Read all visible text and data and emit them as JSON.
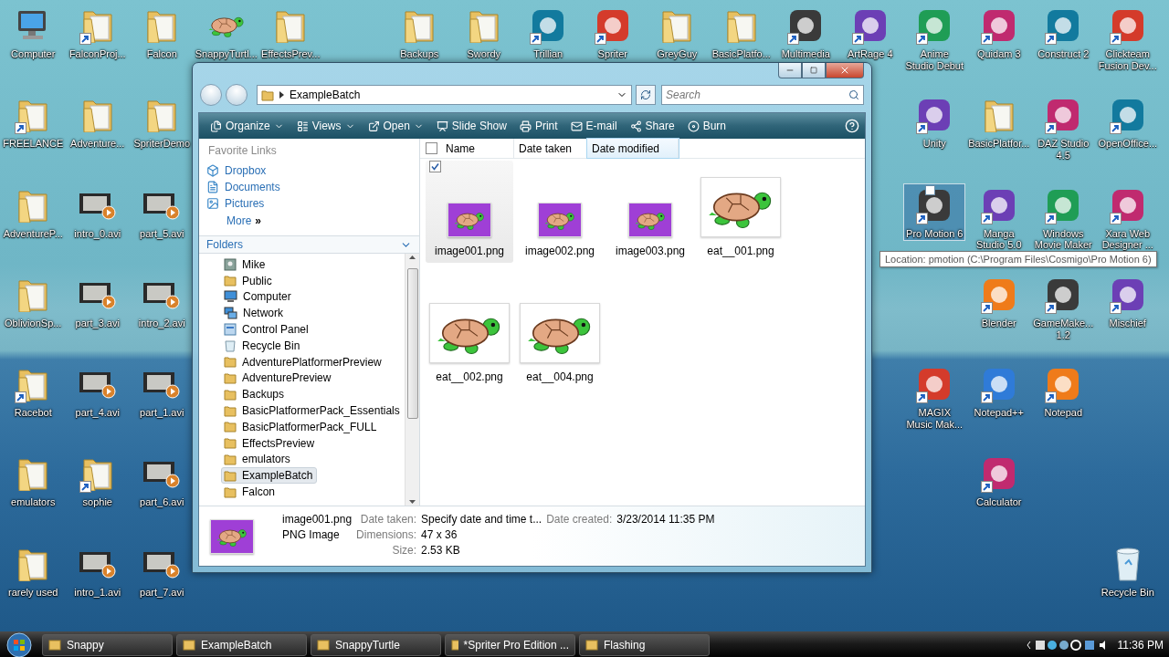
{
  "desktop_icons": [
    {
      "label": "Computer",
      "kind": "computer",
      "shortcut": false,
      "selected": false
    },
    {
      "label": "FalconProj...",
      "kind": "folder",
      "shortcut": true,
      "selected": false
    },
    {
      "label": "Falcon",
      "kind": "folder",
      "shortcut": false,
      "selected": false
    },
    {
      "label": "SnappyTurtl...",
      "kind": "turtle",
      "shortcut": false,
      "selected": false
    },
    {
      "label": "EffectsPrev...",
      "kind": "folder",
      "shortcut": false,
      "selected": false
    },
    {
      "label": "Backups",
      "kind": "folder",
      "shortcut": false,
      "selected": false
    },
    {
      "label": "Swordy",
      "kind": "folder",
      "shortcut": false,
      "selected": false
    },
    {
      "label": "Trillian",
      "kind": "app",
      "shortcut": true,
      "selected": false
    },
    {
      "label": "Spriter",
      "kind": "app",
      "shortcut": true,
      "selected": false
    },
    {
      "label": "GreyGuy",
      "kind": "folder",
      "shortcut": false,
      "selected": false
    },
    {
      "label": "BasicPlatfo...",
      "kind": "folder",
      "shortcut": false,
      "selected": false
    },
    {
      "label": "Multimedia",
      "kind": "app",
      "shortcut": true,
      "selected": false
    },
    {
      "label": "ArtRage 4",
      "kind": "app",
      "shortcut": true,
      "selected": false
    },
    {
      "label": "Anime Studio Debut",
      "kind": "app",
      "shortcut": true,
      "selected": false
    },
    {
      "label": "Quidam 3",
      "kind": "app",
      "shortcut": true,
      "selected": false
    },
    {
      "label": "Construct 2",
      "kind": "app",
      "shortcut": true,
      "selected": false
    },
    {
      "label": "Clickteam Fusion Dev...",
      "kind": "app",
      "shortcut": true,
      "selected": false
    },
    {
      "label": "FREELANCE",
      "kind": "folder",
      "shortcut": true,
      "selected": false
    },
    {
      "label": "Adventure...",
      "kind": "folder",
      "shortcut": false,
      "selected": false
    },
    {
      "label": "SpriterDemo",
      "kind": "folder",
      "shortcut": false,
      "selected": false
    },
    {
      "label": "Unity",
      "kind": "app",
      "shortcut": true,
      "selected": false
    },
    {
      "label": "BasicPlatfor...",
      "kind": "folder",
      "shortcut": false,
      "selected": false
    },
    {
      "label": "DAZ Studio 4.5",
      "kind": "app",
      "shortcut": true,
      "selected": false
    },
    {
      "label": "OpenOffice...",
      "kind": "app",
      "shortcut": true,
      "selected": false
    },
    {
      "label": "AdventureP...",
      "kind": "folder",
      "shortcut": false,
      "selected": false
    },
    {
      "label": "intro_0.avi",
      "kind": "video",
      "shortcut": false,
      "selected": false
    },
    {
      "label": "part_5.avi",
      "kind": "video",
      "shortcut": false,
      "selected": false
    },
    {
      "label": "Pro Motion 6",
      "kind": "app",
      "shortcut": true,
      "selected": true
    },
    {
      "label": "Manga Studio 5.0",
      "kind": "app",
      "shortcut": true,
      "selected": false
    },
    {
      "label": "Windows Movie Maker",
      "kind": "app",
      "shortcut": true,
      "selected": false
    },
    {
      "label": "Xara Web Designer ...",
      "kind": "app",
      "shortcut": true,
      "selected": false
    },
    {
      "label": "OblivionSp...",
      "kind": "folder",
      "shortcut": false,
      "selected": false
    },
    {
      "label": "part_3.avi",
      "kind": "video",
      "shortcut": false,
      "selected": false
    },
    {
      "label": "intro_2.avi",
      "kind": "video",
      "shortcut": false,
      "selected": false
    },
    {
      "label": "Blender",
      "kind": "app",
      "shortcut": true,
      "selected": false
    },
    {
      "label": "GameMake... 1.2",
      "kind": "app",
      "shortcut": true,
      "selected": false
    },
    {
      "label": "Mischief",
      "kind": "app",
      "shortcut": true,
      "selected": false
    },
    {
      "label": "Racebot",
      "kind": "folder",
      "shortcut": true,
      "selected": false
    },
    {
      "label": "part_4.avi",
      "kind": "video",
      "shortcut": false,
      "selected": false
    },
    {
      "label": "part_1.avi",
      "kind": "video",
      "shortcut": false,
      "selected": false
    },
    {
      "label": "MAGIX Music Mak...",
      "kind": "app",
      "shortcut": true,
      "selected": false
    },
    {
      "label": "Notepad++",
      "kind": "app",
      "shortcut": true,
      "selected": false
    },
    {
      "label": "Notepad",
      "kind": "app",
      "shortcut": true,
      "selected": false
    },
    {
      "label": "emulators",
      "kind": "folder",
      "shortcut": false,
      "selected": false
    },
    {
      "label": "sophie",
      "kind": "folder",
      "shortcut": true,
      "selected": false
    },
    {
      "label": "part_6.avi",
      "kind": "video",
      "shortcut": false,
      "selected": false
    },
    {
      "label": "Calculator",
      "kind": "app",
      "shortcut": true,
      "selected": false
    },
    {
      "label": "rarely used",
      "kind": "folder",
      "shortcut": false,
      "selected": false
    },
    {
      "label": "intro_1.avi",
      "kind": "video",
      "shortcut": false,
      "selected": false
    },
    {
      "label": "part_7.avi",
      "kind": "video",
      "shortcut": false,
      "selected": false
    },
    {
      "label": "Recycle Bin",
      "kind": "trash",
      "shortcut": false,
      "selected": false
    }
  ],
  "tooltip": "Location: pmotion (C:\\Program Files\\Cosmigo\\Pro Motion 6)",
  "window": {
    "address": "ExampleBatch",
    "search_placeholder": "Search",
    "toolbar": [
      {
        "label": "Organize",
        "dropdown": true
      },
      {
        "label": "Views",
        "dropdown": true
      },
      {
        "label": "Open",
        "dropdown": true
      },
      {
        "label": "Slide Show",
        "dropdown": false
      },
      {
        "label": "Print",
        "dropdown": false
      },
      {
        "label": "E-mail",
        "dropdown": false
      },
      {
        "label": "Share",
        "dropdown": false
      },
      {
        "label": "Burn",
        "dropdown": false
      }
    ],
    "favorite_links": {
      "title": "Favorite Links",
      "items": [
        "Dropbox",
        "Documents",
        "Pictures"
      ],
      "more": "More",
      "more_glyph": "»"
    },
    "folders": {
      "title": "Folders",
      "items": [
        {
          "label": "Mike",
          "kind": "user",
          "selected": false
        },
        {
          "label": "Public",
          "kind": "folder",
          "selected": false
        },
        {
          "label": "Computer",
          "kind": "computer",
          "selected": false
        },
        {
          "label": "Network",
          "kind": "network",
          "selected": false
        },
        {
          "label": "Control Panel",
          "kind": "panel",
          "selected": false
        },
        {
          "label": "Recycle Bin",
          "kind": "trash",
          "selected": false
        },
        {
          "label": "AdventurePlatformerPreview",
          "kind": "folder",
          "selected": false
        },
        {
          "label": "AdventurePreview",
          "kind": "folder",
          "selected": false
        },
        {
          "label": "Backups",
          "kind": "folder",
          "selected": false
        },
        {
          "label": "BasicPlatformerPack_Essentials",
          "kind": "folder",
          "selected": false
        },
        {
          "label": "BasicPlatformerPack_FULL",
          "kind": "folder",
          "selected": false
        },
        {
          "label": "EffectsPreview",
          "kind": "folder",
          "selected": false
        },
        {
          "label": "emulators",
          "kind": "folder",
          "selected": false
        },
        {
          "label": "ExampleBatch",
          "kind": "folder",
          "selected": true
        },
        {
          "label": "Falcon",
          "kind": "folder",
          "selected": false
        }
      ]
    },
    "select_all_checked": false,
    "columns": [
      {
        "label": "Name",
        "hovered": false
      },
      {
        "label": "Date taken",
        "hovered": false
      },
      {
        "label": "Date modified",
        "hovered": true
      }
    ],
    "files": [
      {
        "name": "image001.png",
        "kind": "small",
        "selected": true
      },
      {
        "name": "image002.png",
        "kind": "small",
        "selected": false
      },
      {
        "name": "image003.png",
        "kind": "small",
        "selected": false
      },
      {
        "name": "eat__001.png",
        "kind": "large",
        "selected": false
      },
      {
        "name": "eat__002.png",
        "kind": "large",
        "selected": false
      },
      {
        "name": "eat__004.png",
        "kind": "large",
        "selected": false
      }
    ],
    "details": {
      "name": "image001.png",
      "type": "PNG Image",
      "fields": [
        {
          "label": "Date taken:",
          "value": "Specify date and time t..."
        },
        {
          "label": "Date created:",
          "value": "3/23/2014 11:35 PM"
        },
        {
          "label": "Dimensions:",
          "value": "47 x 36"
        },
        {
          "label": "Size:",
          "value": "2.53 KB"
        }
      ]
    }
  },
  "taskbar": {
    "buttons": [
      "Snappy",
      "ExampleBatch",
      "SnappyTurtle",
      "*Spriter Pro Edition ...",
      "Flashing"
    ],
    "clock": "11:36 PM"
  }
}
